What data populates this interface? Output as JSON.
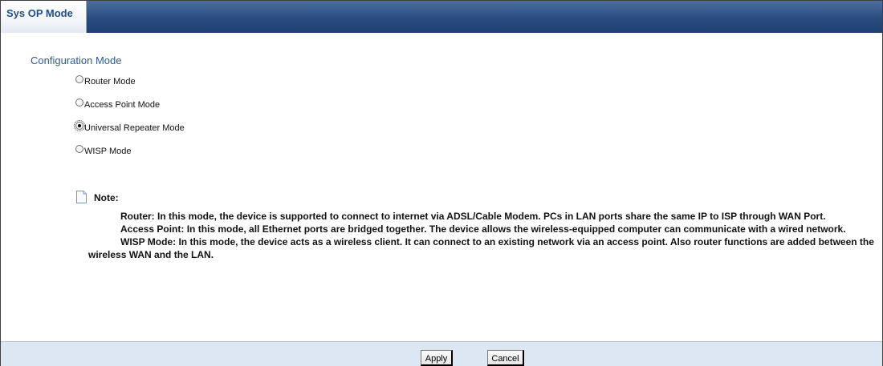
{
  "tab": {
    "label": "Sys OP Mode"
  },
  "section": {
    "title": "Configuration Mode"
  },
  "modes": [
    {
      "label": "Router Mode",
      "checked": false
    },
    {
      "label": "Access Point Mode",
      "checked": false
    },
    {
      "label": "Universal Repeater Mode",
      "checked": true
    },
    {
      "label": "WISP Mode",
      "checked": false
    }
  ],
  "note": {
    "title": "Note:",
    "paragraphs": [
      "Router: In this mode, the device is supported to connect to internet via ADSL/Cable Modem. PCs in LAN ports share the same IP to ISP through WAN Port.",
      "Access Point: In this mode, all Ethernet ports are bridged together. The device allows the wireless-equipped computer can communicate with a wired network.",
      "WISP Mode: In this mode, the device acts as a wireless client. It can connect to an existing network via an access point. Also router functions are added between the wireless WAN and the LAN."
    ]
  },
  "buttons": {
    "apply": "Apply",
    "cancel": "Cancel"
  },
  "colors": {
    "tab_bar": "#2a4d80",
    "title_text": "#2f5a97",
    "footer": "#dde6f3"
  }
}
